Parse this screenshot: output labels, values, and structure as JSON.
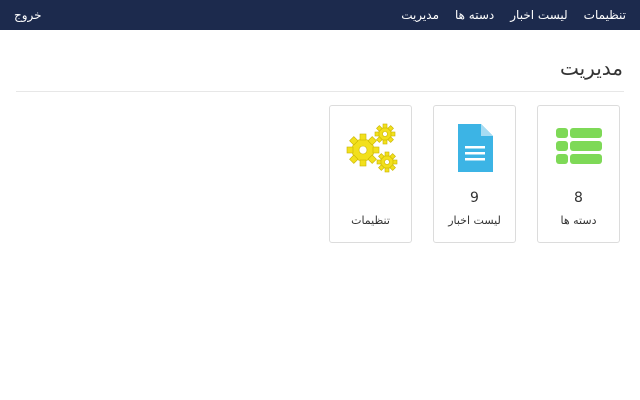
{
  "navbar": {
    "items": [
      "مدیریت",
      "دسته ها",
      "لیست اخبار",
      "تنظیمات"
    ],
    "logout": "خروج"
  },
  "page": {
    "title": "مدیریت"
  },
  "cards": [
    {
      "count": "8",
      "label": "دسته ها",
      "icon": "list-icon",
      "color": "#7ed957"
    },
    {
      "count": "9",
      "label": "لیست اخبار",
      "icon": "document-icon",
      "color": "#3cb4e5"
    },
    {
      "count": "",
      "label": "تنظیمات",
      "icon": "gears-icon",
      "color": "#f2e01c"
    }
  ],
  "colors": {
    "navbar": "#1c2a4d"
  }
}
